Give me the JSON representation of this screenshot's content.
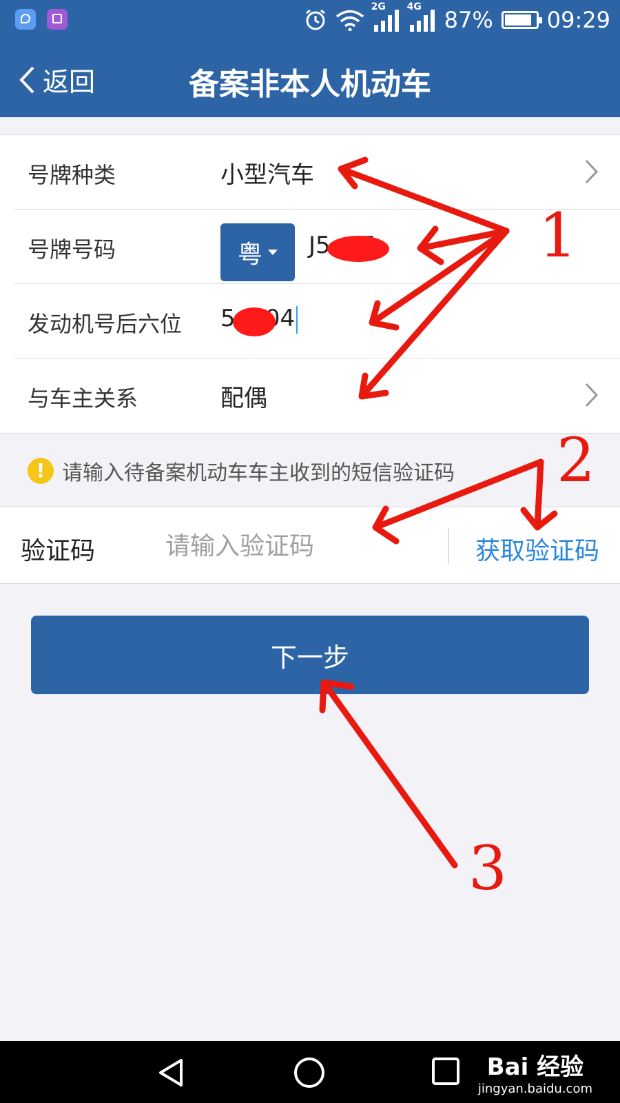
{
  "status_bar": {
    "battery_percent": "87%",
    "battery_level": 0.87,
    "time": "09:29",
    "network_2g": "2G",
    "network_4g": "4G",
    "icons": [
      "location-app-icon",
      "gallery-app-icon",
      "alarm-icon",
      "wifi-icon",
      "signal-icon",
      "battery-icon"
    ]
  },
  "nav": {
    "back_label": "返回",
    "title": "备案非本人机动车"
  },
  "form": {
    "plate_type": {
      "label": "号牌种类",
      "value": "小型汽车"
    },
    "plate_number": {
      "label": "号牌号码",
      "province": "粤",
      "value": "J5    7"
    },
    "engine": {
      "label": "发动机号后六位",
      "value": "5    04"
    },
    "relation": {
      "label": "与车主关系",
      "value": "配偶"
    }
  },
  "hint": {
    "icon": "warning-icon",
    "text": "请输入待备案机动车车主收到的短信验证码"
  },
  "verify": {
    "label": "验证码",
    "placeholder": "请输入验证码",
    "value": "",
    "get_code_label": "获取验证码"
  },
  "next_label": "下一步",
  "annotations": {
    "n1": "1",
    "n2": "2",
    "n3": "3",
    "color": "#e81a10"
  },
  "watermark": {
    "logo": "Bai 经验",
    "url": "jingyan.baidu.com"
  },
  "colors": {
    "primary": "#2d64a6",
    "link": "#2a86e0",
    "background": "#f2f2f7"
  }
}
